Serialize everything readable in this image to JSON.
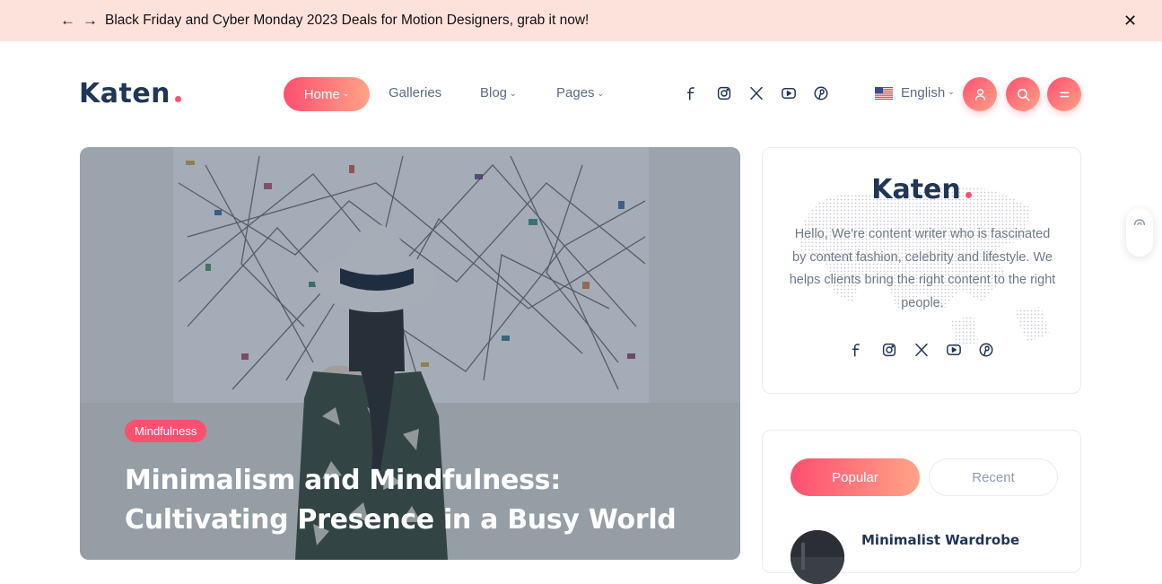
{
  "announcement": {
    "prev_icon": "arrow-left-icon",
    "next_icon": "arrow-right-icon",
    "text": "Black Friday and Cyber Monday 2023 Deals for Motion Designers, grab it now!",
    "close_icon": "close-icon"
  },
  "header": {
    "logo": "Katen",
    "nav": [
      {
        "label": "Home",
        "active": true,
        "dropdown": true
      },
      {
        "label": "Galleries",
        "active": false,
        "dropdown": false
      },
      {
        "label": "Blog",
        "active": false,
        "dropdown": true
      },
      {
        "label": "Pages",
        "active": false,
        "dropdown": true
      }
    ],
    "social": [
      "facebook-icon",
      "instagram-icon",
      "x-icon",
      "youtube-icon",
      "pinterest-icon"
    ],
    "language": "English",
    "actions": [
      "user-icon",
      "search-icon",
      "menu-icon"
    ]
  },
  "hero": {
    "category": "Mindfulness",
    "title": "Minimalism and Mindfulness: Cultivating Presence in a Busy World"
  },
  "about_widget": {
    "logo": "Katen",
    "text": "Hello, We're content writer who is fascinated by content fashion, celebrity and lifestyle. We helps clients bring the right content to the right people.",
    "social": [
      "facebook-icon",
      "instagram-icon",
      "x-icon",
      "youtube-icon",
      "pinterest-icon"
    ]
  },
  "tabs_widget": {
    "tabs": [
      {
        "label": "Popular",
        "active": true
      },
      {
        "label": "Recent",
        "active": false
      }
    ],
    "posts": [
      {
        "title": "Minimalist Wardrobe"
      }
    ]
  },
  "colors": {
    "accent": "#fe4f70",
    "accent_light": "#ffa387",
    "navy": "#203656",
    "announcement_bg": "#fde2dc"
  }
}
